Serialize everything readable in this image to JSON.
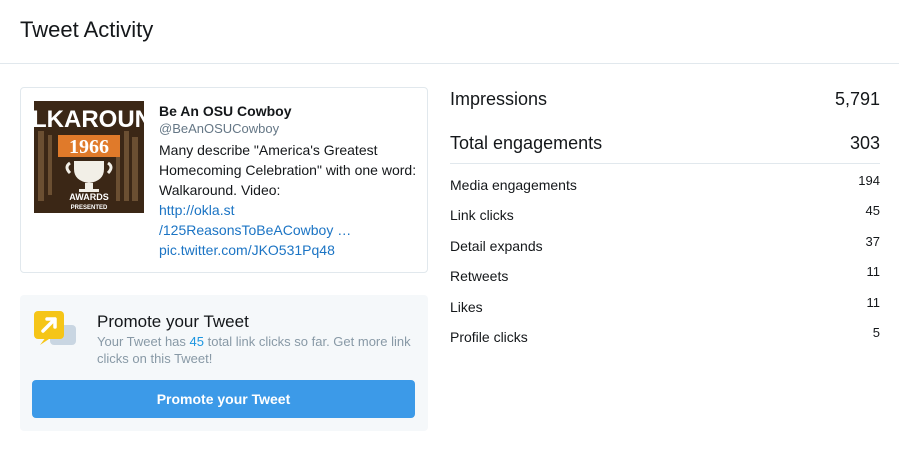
{
  "page": {
    "title": "Tweet Activity"
  },
  "tweet": {
    "author_name": "Be An OSU Cowboy",
    "handle": "@BeAnOSUCowboy",
    "text": "Many describe \"America's Greatest Homecoming Celebration\" with one word: Walkaround. Video:",
    "links": [
      "http://okla.st",
      "/125ReasonsToBeACowboy …",
      "pic.twitter.com/JKO531Pq48"
    ],
    "media": {
      "word": "LKAROUND",
      "year": "1966",
      "caption_1": "AWARDS",
      "caption_2": "PRESENTED"
    }
  },
  "promo": {
    "title": "Promote your Tweet",
    "text_before": "Your Tweet has ",
    "count": "45",
    "text_after": " total link clicks so far. Get more link clicks on this Tweet!",
    "button_label": "Promote your Tweet",
    "icon": "megaphone-icon"
  },
  "stats": {
    "impressions": {
      "label": "Impressions",
      "value": "5,791"
    },
    "total_engagements": {
      "label": "Total engagements",
      "value": "303"
    },
    "rows": [
      {
        "label": "Media engagements",
        "value": "194"
      },
      {
        "label": "Link clicks",
        "value": "45"
      },
      {
        "label": "Detail expands",
        "value": "37"
      },
      {
        "label": "Retweets",
        "value": "11"
      },
      {
        "label": "Likes",
        "value": "11"
      },
      {
        "label": "Profile clicks",
        "value": "5"
      }
    ]
  },
  "colors": {
    "link": "#1b74c4",
    "accent": "#1b95e0",
    "button": "#3c9ae8",
    "promo_bg": "#f5f8fa",
    "icon_yellow": "#f5c518"
  }
}
